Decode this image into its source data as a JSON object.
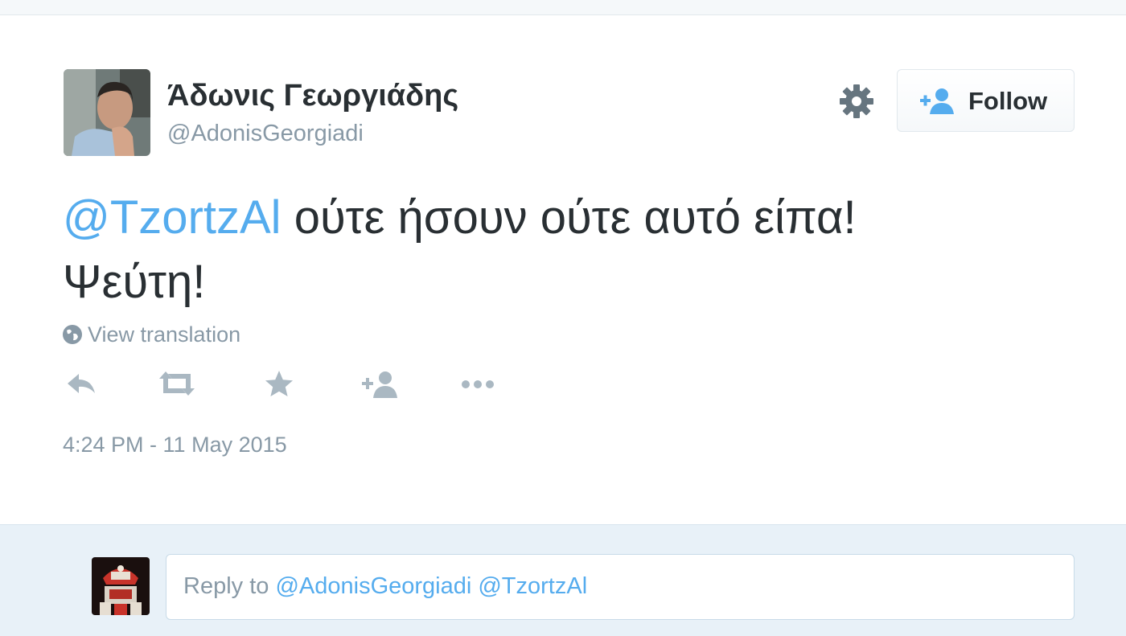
{
  "author": {
    "name": "Άδωνις Γεωργιάδης",
    "handle": "@AdonisGeorgiadi"
  },
  "header_actions": {
    "settings_icon": "gear-icon",
    "follow_label": "Follow"
  },
  "tweet": {
    "mention": "@TzortzAl",
    "text_line1": " ούτε ήσουν ούτε αυτό είπα!",
    "text_line2": "Ψεύτη!",
    "view_translation": "View translation",
    "timestamp": "4:24 PM - 11 May 2015"
  },
  "actions": [
    {
      "name": "reply",
      "icon": "reply-icon"
    },
    {
      "name": "retweet",
      "icon": "retweet-icon"
    },
    {
      "name": "favorite",
      "icon": "star-icon"
    },
    {
      "name": "follow",
      "icon": "add-user-icon"
    },
    {
      "name": "more",
      "icon": "more-icon"
    }
  ],
  "reply": {
    "prefix": "Reply to ",
    "handles": "@AdonisGeorgiadi @TzortzAl"
  },
  "colors": {
    "link": "#55acee",
    "muted": "#8899a6",
    "text": "#292f33",
    "reply_bg": "#e8f1f8",
    "icon_grey": "#aab8c2"
  }
}
